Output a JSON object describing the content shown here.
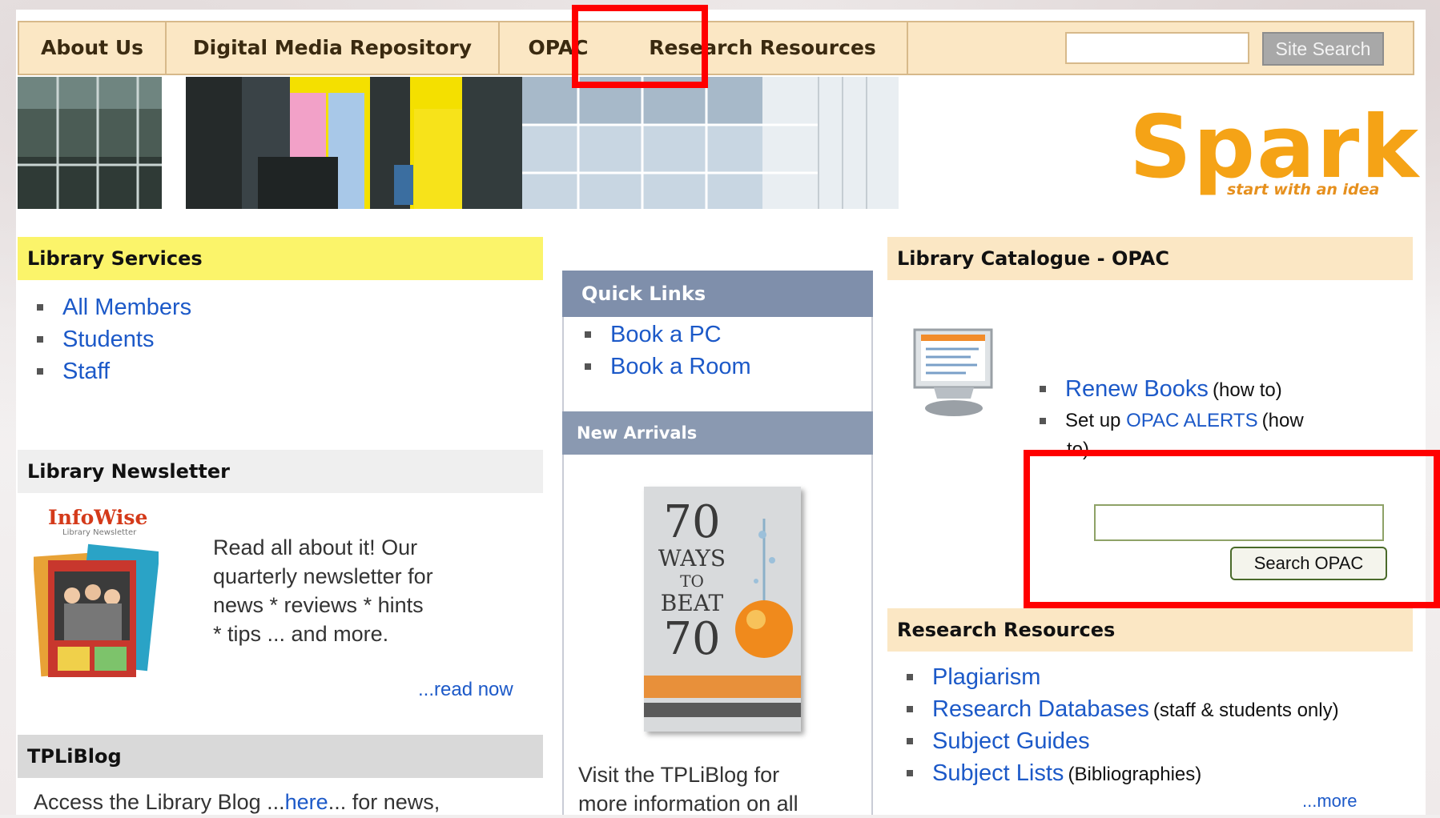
{
  "nav": {
    "items": [
      "About Us",
      "Digital Media Repository",
      "OPAC",
      "Research Resources"
    ],
    "site_search_button": "Site Search",
    "site_search_value": ""
  },
  "logo": {
    "main": "Spark",
    "tagline": "start with an idea"
  },
  "library_services": {
    "title": "Library Services",
    "items": [
      "All Members",
      "Students",
      "Staff"
    ]
  },
  "newsletter": {
    "title": "Library Newsletter",
    "cover_title": "InfoWise",
    "cover_subtitle": "Library Newsletter",
    "description_lines": [
      "Read all about it! Our",
      "quarterly newsletter for",
      "news * reviews * hints",
      "* tips ... and more."
    ],
    "read_now": "...read now"
  },
  "tplblog": {
    "title": "TPLiBlog",
    "text_before": "Access the Library Blog ...",
    "here_link": "here",
    "text_after": "... for news,"
  },
  "quick_links": {
    "title": "Quick Links",
    "items": [
      "Book a PC",
      "Book a Room"
    ]
  },
  "new_arrivals": {
    "title": "New Arrivals",
    "book_lines": [
      "70",
      "WAYS",
      "TO",
      "BEAT",
      "70"
    ],
    "visit_lines": [
      "Visit the TPLiBlog for",
      "more information on all"
    ]
  },
  "opac": {
    "title": "Library Catalogue - OPAC",
    "renew_link": "Renew Books",
    "renew_note": "(how to)",
    "setup_prefix": "Set up ",
    "alerts_link": "OPAC ALERTS",
    "alerts_note_1": "(how",
    "alerts_note_2": "to)",
    "search_value": "",
    "search_button": "Search OPAC"
  },
  "research": {
    "title": "Research Resources",
    "items": [
      {
        "link": "Plagiarism",
        "note": ""
      },
      {
        "link": "Research Databases",
        "note": "(staff & students only)"
      },
      {
        "link": "Subject Guides",
        "note": ""
      },
      {
        "link": "Subject Lists",
        "note": "(Bibliographies)"
      }
    ],
    "more": "...more"
  },
  "colors": {
    "nav_bg": "#fbe7c4",
    "library_services_header": "#fbf46a",
    "quick_links_header": "#7f8fab",
    "opac_header": "#fbe7c4",
    "link": "#1c59c8",
    "spark_orange": "#f5a316",
    "highlight_red": "#ff0000"
  }
}
